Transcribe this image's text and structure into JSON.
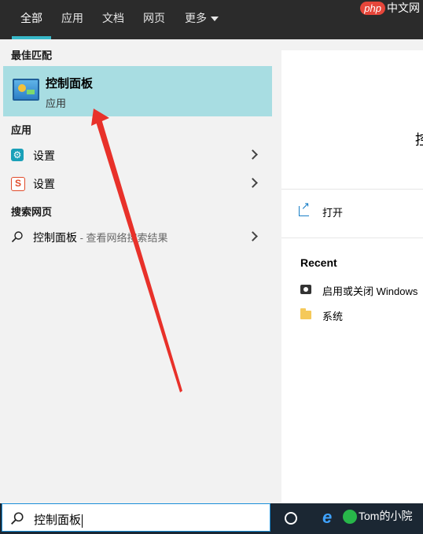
{
  "tabs": [
    {
      "label": "全部",
      "active": true
    },
    {
      "label": "应用"
    },
    {
      "label": "文档"
    },
    {
      "label": "网页"
    },
    {
      "label": "更多"
    }
  ],
  "watermark": {
    "logo": "php",
    "text": "中文网"
  },
  "sections": {
    "best_match": "最佳匹配",
    "apps": "应用",
    "web_search": "搜索网页"
  },
  "best_match": {
    "title": "控制面板",
    "subtitle": "应用",
    "icon": "control-panel-icon"
  },
  "apps": [
    {
      "label": "设置",
      "icon": "settings-gear-icon"
    },
    {
      "label": "设置",
      "icon": "sogou-settings-icon"
    }
  ],
  "web_result": {
    "label": "控制面板",
    "suffix": " - 查看网络搜索结果",
    "icon": "search-icon"
  },
  "right_panel": {
    "title_fragment": "控",
    "open_label": "打开",
    "recent_heading": "Recent",
    "recent": [
      {
        "label": "启用或关闭 Windows",
        "icon": "windows-feature-icon"
      },
      {
        "label": "系统",
        "icon": "folder-icon"
      }
    ]
  },
  "search_box": {
    "value": "控制面板"
  },
  "taskbar": {
    "watermark": "Tom的小院"
  },
  "accent": "#38b8c8",
  "selection_color": "#a8dde2",
  "annotation_color": "#e8312a"
}
